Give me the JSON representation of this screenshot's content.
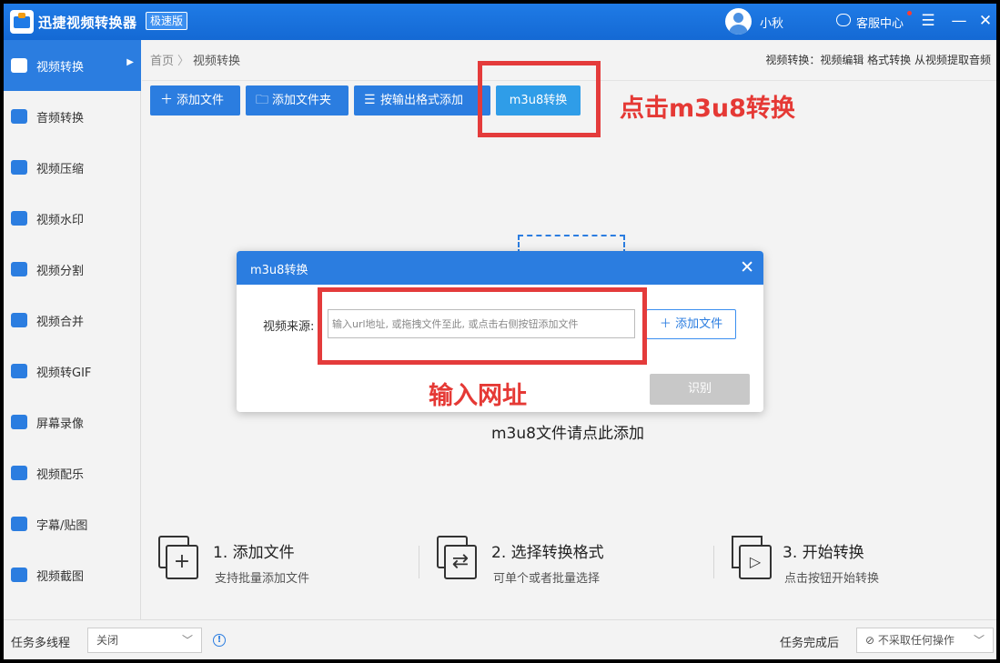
{
  "app": {
    "title": "迅捷视频转换器",
    "edition_badge": "极速版",
    "user_name": "小秋",
    "service_label": "客服中心"
  },
  "sidebar": {
    "items": [
      {
        "label": "视频转换",
        "active": true
      },
      {
        "label": "音频转换"
      },
      {
        "label": "视频压缩"
      },
      {
        "label": "视频水印"
      },
      {
        "label": "视频分割"
      },
      {
        "label": "视频合并"
      },
      {
        "label": "视频转GIF"
      },
      {
        "label": "屏幕录像"
      },
      {
        "label": "视频配乐"
      },
      {
        "label": "字幕/贴图"
      },
      {
        "label": "视频截图"
      }
    ]
  },
  "breadcrumb": {
    "home": "首页",
    "current": "视频转换"
  },
  "top_right_text": "视频转换：视频编辑 格式转换 从视频提取音频",
  "toolbar": {
    "add_file": "添加文件",
    "add_folder": "添加文件夹",
    "add_by_format": "按输出格式添加",
    "m3u8": "m3u8转换"
  },
  "annotations": {
    "click_m3u8": "点击m3u8转换",
    "enter_url": "输入网址",
    "color": "#e43b3b"
  },
  "drop_area": {
    "text": "m3u8文件请点此添加"
  },
  "dialog": {
    "title": "m3u8转换",
    "source_label": "视频来源:",
    "input_placeholder": "输入url地址, 或拖拽文件至此, 或点击右侧按钮添加文件",
    "add_file": "添加文件",
    "recognize": "识别"
  },
  "steps": [
    {
      "title": "1. 添加文件",
      "sub": "支持批量添加文件"
    },
    {
      "title": "2. 选择转换格式",
      "sub": "可单个或者批量选择"
    },
    {
      "title": "3. 开始转换",
      "sub": "点击按钮开始转换"
    }
  ],
  "bottom": {
    "multithread_label": "任务多线程",
    "multithread_value": "关闭",
    "after_complete_label": "任务完成后",
    "after_complete_value": "不采取任何操作"
  },
  "colors": {
    "primary": "#2b7de0",
    "annotation": "#e43b3b"
  }
}
